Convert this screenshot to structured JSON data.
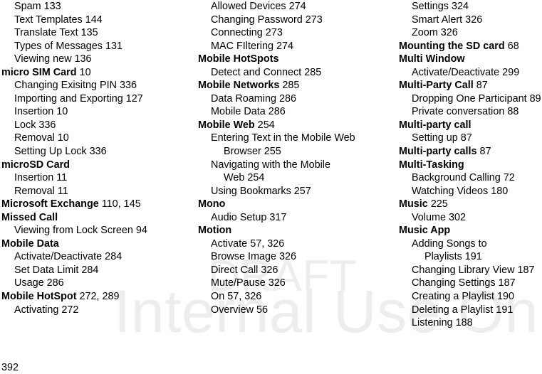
{
  "document": {
    "type": "index",
    "page_number": "392",
    "watermark": {
      "line1": "DRAFT",
      "line2": "Internal Use Only",
      "color": "#ededed"
    }
  },
  "columns": [
    {
      "id": "column-1",
      "entries": [
        {
          "level": 1,
          "term": "Spam",
          "pages": "133"
        },
        {
          "level": 1,
          "term": "Text Templates",
          "pages": "144"
        },
        {
          "level": 1,
          "term": "Translate Text",
          "pages": "135"
        },
        {
          "level": 1,
          "term": "Types of Messages",
          "pages": "131"
        },
        {
          "level": 1,
          "term": "Viewing new",
          "pages": "136"
        },
        {
          "level": 0,
          "term": "micro SIM Card",
          "pages": "10"
        },
        {
          "level": 1,
          "term": "Changing Exisitng PIN",
          "pages": "336"
        },
        {
          "level": 1,
          "term": "Importing and Exporting",
          "pages": "127"
        },
        {
          "level": 1,
          "term": "Insertion",
          "pages": "10"
        },
        {
          "level": 1,
          "term": "Lock",
          "pages": "336"
        },
        {
          "level": 1,
          "term": "Removal",
          "pages": "10"
        },
        {
          "level": 1,
          "term": "Setting Up Lock",
          "pages": "336"
        },
        {
          "level": 0,
          "term": "microSD Card",
          "pages": ""
        },
        {
          "level": 1,
          "term": "Insertion",
          "pages": "11"
        },
        {
          "level": 1,
          "term": "Removal",
          "pages": "11"
        },
        {
          "level": 0,
          "term": "Microsoft Exchange",
          "pages": "110, 145"
        },
        {
          "level": 0,
          "term": "Missed Call",
          "pages": ""
        },
        {
          "level": 1,
          "term": "Viewing from Lock Screen",
          "pages": "94"
        },
        {
          "level": 0,
          "term": "Mobile Data",
          "pages": ""
        },
        {
          "level": 1,
          "term": "Activate/Deactivate",
          "pages": "284"
        },
        {
          "level": 1,
          "term": "Set Data Limit",
          "pages": "284"
        },
        {
          "level": 1,
          "term": "Usage",
          "pages": "286"
        },
        {
          "level": 0,
          "term": "Mobile HotSpot",
          "pages": "272, 289"
        },
        {
          "level": 1,
          "term": "Activating",
          "pages": "272"
        }
      ]
    },
    {
      "id": "column-2",
      "entries": [
        {
          "level": 1,
          "term": "Allowed Devices",
          "pages": "274"
        },
        {
          "level": 1,
          "term": "Changing Password",
          "pages": "273"
        },
        {
          "level": 1,
          "term": "Connecting",
          "pages": "273"
        },
        {
          "level": 1,
          "term": "MAC FIltering",
          "pages": "274"
        },
        {
          "level": 0,
          "term": "Mobile HotSpots",
          "pages": ""
        },
        {
          "level": 1,
          "term": "Detect and Connect",
          "pages": "285"
        },
        {
          "level": 0,
          "term": "Mobile Networks",
          "pages": "285"
        },
        {
          "level": 1,
          "term": "Data Roaming",
          "pages": "286"
        },
        {
          "level": 1,
          "term": "Mobile Data",
          "pages": "286"
        },
        {
          "level": 0,
          "term": "Mobile Web",
          "pages": "254"
        },
        {
          "level": 1,
          "term": "Entering Text in the Mobile Web Browser",
          "pages": "255"
        },
        {
          "level": 1,
          "term": "Navigating with the Mobile Web",
          "pages": "254"
        },
        {
          "level": 1,
          "term": "Using Bookmarks",
          "pages": "257"
        },
        {
          "level": 0,
          "term": "Mono",
          "pages": ""
        },
        {
          "level": 1,
          "term": "Audio Setup",
          "pages": "317"
        },
        {
          "level": 0,
          "term": "Motion",
          "pages": ""
        },
        {
          "level": 1,
          "term": "Activate",
          "pages": "57, 326"
        },
        {
          "level": 1,
          "term": "Browse Image",
          "pages": "326"
        },
        {
          "level": 1,
          "term": "Direct Call",
          "pages": "326"
        },
        {
          "level": 1,
          "term": "Mute/Pause",
          "pages": "326"
        },
        {
          "level": 1,
          "term": "On",
          "pages": "57, 326"
        },
        {
          "level": 1,
          "term": "Overview",
          "pages": "56"
        }
      ]
    },
    {
      "id": "column-3",
      "entries": [
        {
          "level": 1,
          "term": "Settings",
          "pages": "324"
        },
        {
          "level": 1,
          "term": "Smart Alert",
          "pages": "326"
        },
        {
          "level": 1,
          "term": "Zoom",
          "pages": "326"
        },
        {
          "level": 0,
          "term": "Mounting the SD card",
          "pages": "68"
        },
        {
          "level": 0,
          "term": "Multi Window",
          "pages": ""
        },
        {
          "level": 1,
          "term": "Activate/Deactivate",
          "pages": "299"
        },
        {
          "level": 0,
          "term": "Multi-Party Call",
          "pages": "87"
        },
        {
          "level": 1,
          "term": "Dropping One Participant",
          "pages": "89"
        },
        {
          "level": 1,
          "term": "Private conversation",
          "pages": "88"
        },
        {
          "level": 0,
          "term": "Multi-party call",
          "pages": ""
        },
        {
          "level": 1,
          "term": "Setting up",
          "pages": "87"
        },
        {
          "level": 0,
          "term": "Multi-party calls",
          "pages": "87"
        },
        {
          "level": 0,
          "term": "Multi-Tasking",
          "pages": ""
        },
        {
          "level": 1,
          "term": "Background Calling",
          "pages": "72"
        },
        {
          "level": 1,
          "term": "Watching Videos",
          "pages": "180"
        },
        {
          "level": 0,
          "term": "Music",
          "pages": "225"
        },
        {
          "level": 1,
          "term": "Volume",
          "pages": "302"
        },
        {
          "level": 0,
          "term": "Music App",
          "pages": ""
        },
        {
          "level": 1,
          "term": "Adding Songs to Playlists",
          "pages": "191"
        },
        {
          "level": 1,
          "term": "Changing Library View",
          "pages": "187"
        },
        {
          "level": 1,
          "term": "Changing Settings",
          "pages": "187"
        },
        {
          "level": 1,
          "term": "Creating a Playlist",
          "pages": "190"
        },
        {
          "level": 1,
          "term": "Deleting a Playlist",
          "pages": "191"
        },
        {
          "level": 1,
          "term": "Listening",
          "pages": "188"
        }
      ]
    }
  ]
}
